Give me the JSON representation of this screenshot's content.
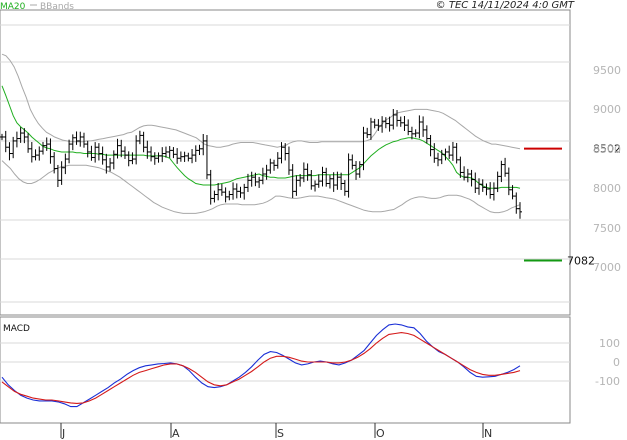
{
  "header": {
    "legend_ma": "MA20",
    "legend_bands": "BBands",
    "copyright": "© TEC 14/11/2024 4:0 GMT"
  },
  "colors": {
    "ma": "#1fae1f",
    "bands": "#a8a8a8",
    "bars": "#000000",
    "resistance": "#cc0000",
    "support": "#139913",
    "macd": "#1a2fd6",
    "signal": "#d41a1a",
    "grid": "#d8d8d8",
    "frame": "#888888"
  },
  "levels": {
    "resistance_label": "8502",
    "support_label": "7082",
    "resistance": 8502,
    "support": 7082
  },
  "chart_data": [
    {
      "type": "ohlc",
      "title": "",
      "x_labels": [
        "J",
        "A",
        "S",
        "O",
        "N"
      ],
      "y_ticks": [
        "9500",
        "9000",
        "8500",
        "8000",
        "7500",
        "7000"
      ],
      "ylim": [
        6550,
        9950
      ],
      "n_days": 123,
      "closes": [
        8650,
        8520,
        8440,
        8600,
        8630,
        8700,
        8650,
        8500,
        8400,
        8420,
        8470,
        8540,
        8560,
        8400,
        8250,
        8100,
        8260,
        8370,
        8560,
        8640,
        8600,
        8650,
        8560,
        8460,
        8390,
        8520,
        8440,
        8360,
        8270,
        8320,
        8430,
        8540,
        8470,
        8420,
        8350,
        8370,
        8600,
        8670,
        8520,
        8460,
        8400,
        8380,
        8410,
        8440,
        8460,
        8480,
        8430,
        8380,
        8400,
        8410,
        8380,
        8420,
        8480,
        8500,
        8600,
        8170,
        7870,
        7920,
        7980,
        7950,
        7890,
        7920,
        7990,
        7960,
        7940,
        8010,
        8100,
        8140,
        8080,
        8100,
        8180,
        8230,
        8320,
        8290,
        8380,
        8520,
        8440,
        8230,
        7960,
        8100,
        8130,
        8240,
        8170,
        8030,
        8050,
        8090,
        8200,
        8060,
        8120,
        8040,
        8140,
        8060,
        7960,
        8360,
        8290,
        8180,
        8300,
        8700,
        8680,
        8840,
        8800,
        8790,
        8850,
        8820,
        8800,
        8930,
        8860,
        8830,
        8800,
        8720,
        8690,
        8700,
        8840,
        8740,
        8630,
        8490,
        8380,
        8360,
        8430,
        8460,
        8420,
        8520,
        8360,
        8200,
        8140,
        8180,
        8110,
        8000,
        8050,
        8010,
        7990,
        7920,
        8000,
        8150,
        8300,
        8190,
        7980,
        7900,
        7740,
        7700
      ],
      "ma20": [
        9300,
        9180,
        9050,
        8920,
        8830,
        8780,
        8740,
        8700,
        8650,
        8610,
        8570,
        8530,
        8510,
        8500,
        8480,
        8470,
        8460,
        8460,
        8460,
        8460,
        8450,
        8450,
        8440,
        8440,
        8440,
        8440,
        8430,
        8430,
        8420,
        8420,
        8420,
        8420,
        8420,
        8420,
        8420,
        8420,
        8420,
        8420,
        8420,
        8410,
        8410,
        8410,
        8410,
        8410,
        8400,
        8380,
        8320,
        8260,
        8210,
        8160,
        8120,
        8090,
        8060,
        8050,
        8040,
        8040,
        8040,
        8040,
        8050,
        8060,
        8070,
        8080,
        8100,
        8120,
        8130,
        8140,
        8150,
        8160,
        8170,
        8180,
        8160,
        8150,
        8140,
        8140,
        8130,
        8130,
        8130,
        8140,
        8150,
        8160,
        8160,
        8160,
        8160,
        8160,
        8160,
        8170,
        8170,
        8170,
        8170,
        8170,
        8170,
        8170,
        8170,
        8170,
        8200,
        8230,
        8260,
        8310,
        8360,
        8410,
        8450,
        8490,
        8520,
        8550,
        8570,
        8590,
        8600,
        8620,
        8630,
        8640,
        8640,
        8630,
        8620,
        8600,
        8570,
        8540,
        8510,
        8480,
        8450,
        8400,
        8350,
        8290,
        8200,
        8160,
        8140,
        8140,
        8130,
        8100,
        8060,
        8030,
        8010,
        8000,
        8000,
        8000,
        8010,
        8010,
        8010,
        8010,
        8010,
        8000
      ],
      "upper_band": [
        9700,
        9680,
        9620,
        9540,
        9420,
        9280,
        9150,
        9000,
        8900,
        8820,
        8760,
        8710,
        8680,
        8650,
        8630,
        8610,
        8600,
        8590,
        8590,
        8590,
        8590,
        8600,
        8600,
        8610,
        8620,
        8630,
        8640,
        8650,
        8660,
        8670,
        8680,
        8700,
        8710,
        8740,
        8770,
        8790,
        8800,
        8800,
        8790,
        8780,
        8770,
        8760,
        8750,
        8740,
        8720,
        8700,
        8680,
        8660,
        8640,
        8600,
        8560,
        8540,
        8530,
        8520,
        8520,
        8530,
        8540,
        8560,
        8570,
        8580,
        8580,
        8580,
        8580,
        8570,
        8560,
        8550,
        8540,
        8530,
        8520,
        8530,
        8540,
        8570,
        8590,
        8600,
        8600,
        8590,
        8580,
        8580,
        8580,
        8590,
        8590,
        8590,
        8590,
        8590,
        8590,
        8590,
        8590,
        8590,
        8590,
        8590,
        8600,
        8620,
        8680,
        8760,
        8820,
        8870,
        8900,
        8940,
        8960,
        8970,
        8980,
        8990,
        9000,
        9000,
        9000,
        9000,
        8990,
        8980,
        8970,
        8950,
        8920,
        8890,
        8860,
        8820,
        8780,
        8740,
        8700,
        8660,
        8630,
        8600,
        8580,
        8560,
        8560,
        8550,
        8540,
        8530,
        8520,
        8510,
        8500
      ],
      "lower_band": [
        8350,
        8300,
        8250,
        8180,
        8120,
        8080,
        8060,
        8060,
        8080,
        8110,
        8150,
        8190,
        8220,
        8250,
        8270,
        8280,
        8290,
        8290,
        8290,
        8290,
        8290,
        8280,
        8270,
        8260,
        8240,
        8220,
        8200,
        8170,
        8140,
        8100,
        8060,
        8020,
        7980,
        7940,
        7900,
        7860,
        7820,
        7790,
        7760,
        7740,
        7720,
        7700,
        7690,
        7680,
        7680,
        7680,
        7680,
        7690,
        7700,
        7720,
        7740,
        7770,
        7790,
        7800,
        7800,
        7800,
        7800,
        7790,
        7790,
        7790,
        7790,
        7800,
        7810,
        7830,
        7860,
        7900,
        7900,
        7890,
        7880,
        7870,
        7870,
        7880,
        7890,
        7900,
        7900,
        7900,
        7890,
        7880,
        7870,
        7860,
        7840,
        7820,
        7800,
        7780,
        7760,
        7740,
        7720,
        7710,
        7700,
        7700,
        7700,
        7710,
        7720,
        7730,
        7760,
        7790,
        7830,
        7860,
        7880,
        7890,
        7890,
        7880,
        7870,
        7870,
        7880,
        7900,
        7910,
        7910,
        7910,
        7900,
        7880,
        7860,
        7830,
        7790,
        7760,
        7730,
        7700,
        7690,
        7690,
        7700,
        7720,
        7750,
        7770,
        7790
      ]
    },
    {
      "type": "line",
      "title": "MACD",
      "y_ticks": [
        "100",
        "0",
        "-100"
      ],
      "ylim": [
        -230,
        230
      ],
      "series": [
        {
          "values": [
            -80,
            -120,
            -150,
            -175,
            -190,
            -200,
            -205,
            -205,
            -205,
            -210,
            -220,
            -235,
            -235,
            -215,
            -195,
            -175,
            -155,
            -135,
            -110,
            -90,
            -65,
            -45,
            -30,
            -20,
            -15,
            -10,
            -8,
            -5,
            -10,
            -20,
            -45,
            -80,
            -110,
            -130,
            -135,
            -130,
            -120,
            -100,
            -80,
            -55,
            -25,
            10,
            40,
            55,
            50,
            35,
            15,
            -5,
            -15,
            -10,
            0,
            5,
            0,
            -10,
            -15,
            -5,
            10,
            35,
            60,
            100,
            140,
            170,
            195,
            200,
            195,
            185,
            180,
            150,
            110,
            80,
            55,
            40,
            20,
            0,
            -25,
            -55,
            -75,
            -80,
            -78,
            -75,
            -65,
            -55,
            -40,
            -20
          ]
        },
        {
          "values": [
            -105,
            -130,
            -155,
            -170,
            -180,
            -190,
            -195,
            -200,
            -200,
            -205,
            -210,
            -215,
            -218,
            -215,
            -205,
            -190,
            -170,
            -150,
            -130,
            -110,
            -90,
            -70,
            -55,
            -45,
            -35,
            -25,
            -15,
            -10,
            -10,
            -20,
            -35,
            -55,
            -80,
            -105,
            -120,
            -125,
            -120,
            -105,
            -90,
            -70,
            -50,
            -25,
            0,
            20,
            30,
            30,
            25,
            15,
            5,
            0,
            0,
            0,
            0,
            -5,
            -5,
            0,
            10,
            25,
            45,
            70,
            100,
            125,
            145,
            150,
            155,
            150,
            140,
            120,
            100,
            80,
            60,
            40,
            20,
            0,
            -20,
            -40,
            -55,
            -65,
            -70,
            -70,
            -65,
            -60,
            -55,
            -45
          ]
        }
      ]
    }
  ]
}
